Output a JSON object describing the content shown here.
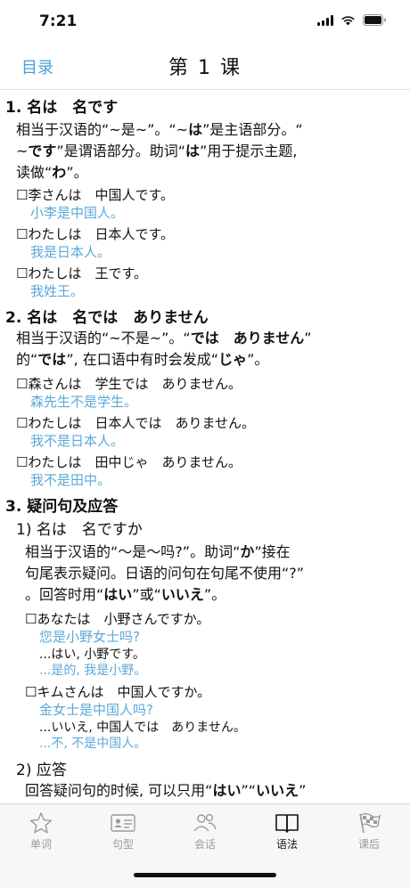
{
  "status": {
    "time": "7:21"
  },
  "nav": {
    "back": "目录",
    "title": "第 1 课"
  },
  "s1": {
    "title": "1. 名は　名です",
    "p1": "相当于汉语的“~是~”。“~",
    "p1b": "は",
    "p1c": "”是主语部分。“",
    "p2a": "~",
    "p2b": "です",
    "p2c": "”是谓语部分。助词“",
    "p2d": "は",
    "p2e": "”用于提示主题,",
    "p3a": "读做“",
    "p3b": "わ",
    "p3c": "”。",
    "ex": [
      {
        "jp": "☐李さんは　中国人です。",
        "cn": "小李是中国人。"
      },
      {
        "jp": "☐わたしは　日本人です。",
        "cn": "我是日本人。"
      },
      {
        "jp": "☐わたしは　王です。",
        "cn": "我姓王。"
      }
    ]
  },
  "s2": {
    "title": "2. 名は　名では　ありません",
    "p1a": "相当于汉语的“~不是~”。“",
    "p1b": "では　ありません",
    "p1c": "”",
    "p2a": "的“",
    "p2b": "では",
    "p2c": "”, 在口语中有时会发成“",
    "p2d": "じゃ",
    "p2e": "”。",
    "ex": [
      {
        "jp": "☐森さんは　学生では　ありません。",
        "cn": "森先生不是学生。"
      },
      {
        "jp": "☐わたしは　日本人では　ありません。",
        "cn": "我不是日本人。"
      },
      {
        "jp": "☐わたしは　田中じゃ　ありません。",
        "cn": "我不是田中。"
      }
    ]
  },
  "s3": {
    "title": "3. 疑问句及应答",
    "sub1": "1) 名は　名ですか",
    "p1a": "相当于汉语的“～是～吗?”。助词“",
    "p1b": "か",
    "p1c": "”接在",
    "p2": "句尾表示疑问。日语的问句在句尾不使用“?”",
    "p3a": "。回答时用“",
    "p3b": "はい",
    "p3c": "”或“",
    "p3d": "いいえ",
    "p3e": "”。",
    "ex": [
      {
        "jp": "☐あなたは　小野さんですか。",
        "cn": "您是小野女士吗?",
        "ans": "...はい, 小野です。",
        "ans_cn": "...是的, 我是小野。"
      },
      {
        "jp": "☐キムさんは　中国人ですか。",
        "cn": "金女士是中国人吗?",
        "ans": "...いいえ, 中国人では　ありません。",
        "ans_cn": "...不, 不是中国人。"
      }
    ],
    "sub2": "2) 应答",
    "p4a": "回答疑问句的时候, 可以只用“",
    "p4b": "はい",
    "p4c": "”“",
    "p4d": "いいえ",
    "p4e": "”"
  },
  "tabs": [
    {
      "label": "单词",
      "icon": "star-icon"
    },
    {
      "label": "句型",
      "icon": "id-card-icon"
    },
    {
      "label": "会话",
      "icon": "people-icon"
    },
    {
      "label": "语法",
      "icon": "book-icon",
      "active": true
    },
    {
      "label": "课后",
      "icon": "checkered-flag-icon"
    }
  ],
  "colors": {
    "accent": "#4a9fd6",
    "translation": "#5aa9d8"
  }
}
